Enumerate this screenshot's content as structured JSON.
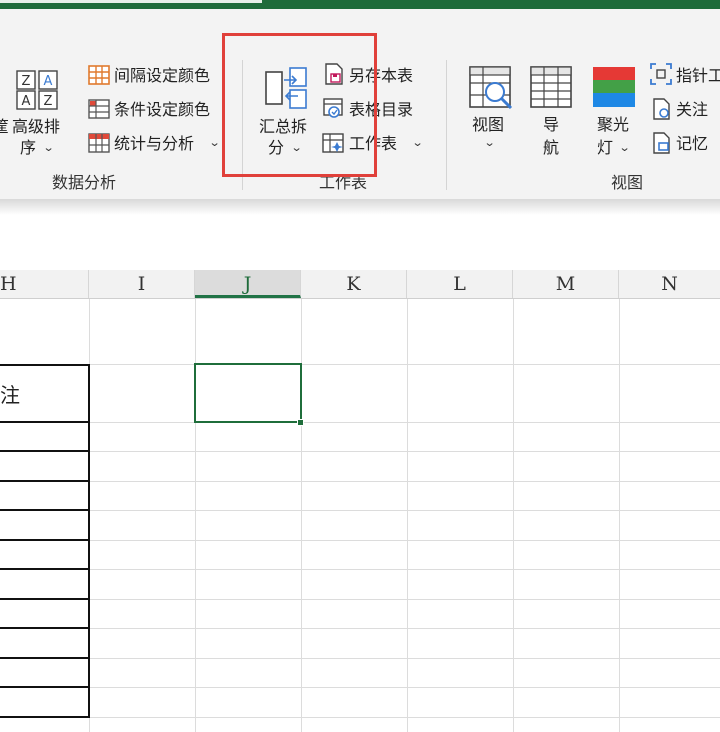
{
  "ribbon": {
    "data_analysis_group": {
      "label": "数据分析",
      "sort_button": {
        "label_line1": "高级排",
        "label_line2": "序",
        "left_fragment": "筐"
      },
      "interval_color": "间隔设定颜色",
      "condition_color": "条件设定颜色",
      "stats_analysis": "统计与分析"
    },
    "worksheet_group": {
      "label": "工作表",
      "summary_split": {
        "label_line1": "汇总拆",
        "label_line2": "分"
      },
      "save_as_table": "另存本表",
      "table_directory": "表格目录",
      "worksheet": "工作表"
    },
    "view_group": {
      "label": "视图",
      "view_button": "视图",
      "nav_button": {
        "label_line1": "导",
        "label_line2": "航"
      },
      "spotlight_button": {
        "label_line1": "聚光",
        "label_line2": "灯"
      },
      "pointer_tool": "指针工",
      "follow": "关注",
      "memory": "记忆"
    }
  },
  "sheet": {
    "columns": [
      "H",
      "I",
      "J",
      "K",
      "L",
      "M",
      "N"
    ],
    "selected_column": "J",
    "cell_text": "注"
  },
  "colors": {
    "accent_green": "#217346",
    "highlight_red": "#e0403a"
  }
}
